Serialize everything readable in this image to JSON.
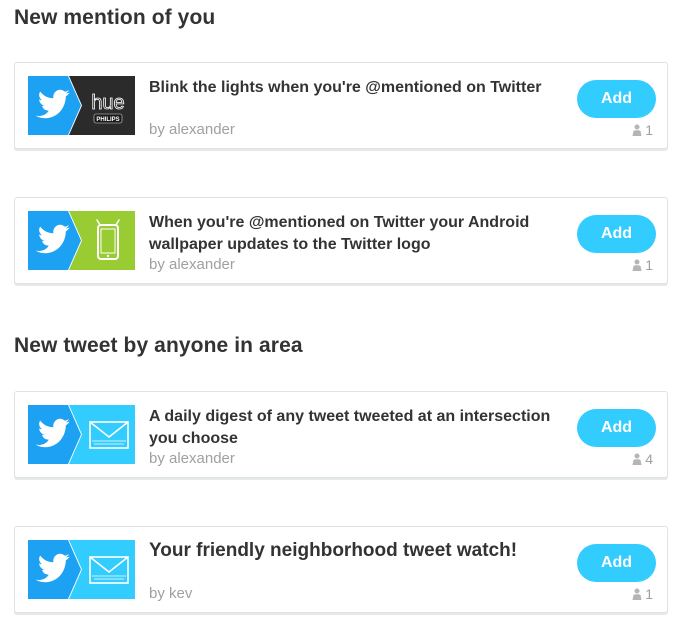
{
  "sections": [
    {
      "title": "New mention of you",
      "cards": [
        {
          "title": "Blink the lights when you're @mentioned on Twitter",
          "author": "by alexander",
          "count": "1",
          "add_label": "Add",
          "trigger_icon": "twitter-icon",
          "action_icon": "philips-hue-icon",
          "action_text_top": "hue",
          "action_text_bottom": "PHILIPS"
        },
        {
          "title": "When you're @mentioned on Twitter your Android wallpaper updates to the Twitter logo",
          "author": "by alexander",
          "count": "1",
          "add_label": "Add",
          "trigger_icon": "twitter-icon",
          "action_icon": "android-device-icon"
        }
      ]
    },
    {
      "title": "New tweet by anyone in area",
      "cards": [
        {
          "title": "A daily digest of any tweet tweeted at an intersection you choose",
          "author": "by alexander",
          "count": "4",
          "add_label": "Add",
          "trigger_icon": "twitter-icon",
          "action_icon": "email-digest-icon"
        },
        {
          "title": "Your friendly neighborhood tweet watch!",
          "author": "by kev",
          "count": "1",
          "add_label": "Add",
          "trigger_icon": "twitter-icon",
          "action_icon": "email-digest-icon"
        }
      ]
    }
  ],
  "colors": {
    "twitter_blue": "#1da1f2",
    "add_button": "#33ccff",
    "android_green": "#99cc33",
    "email_blue": "#33ccff",
    "hue_dark": "#2b2b2b"
  }
}
